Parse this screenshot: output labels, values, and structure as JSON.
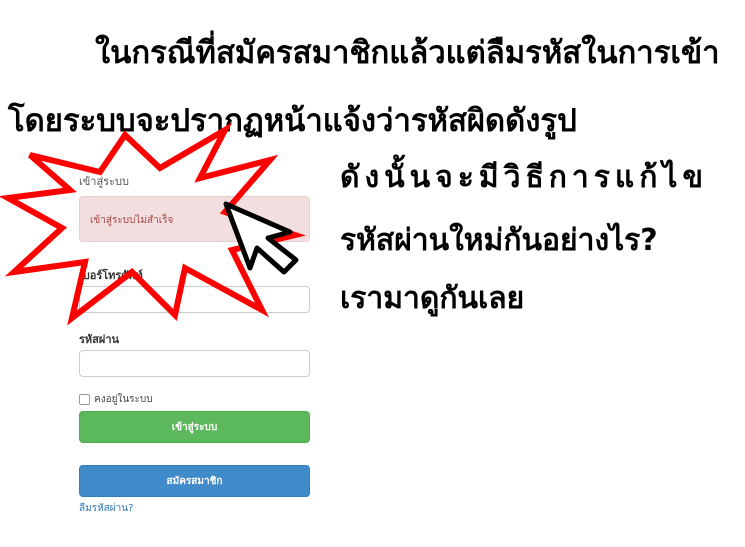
{
  "captions": {
    "line1": "ในกรณีที่สมัครสมาชิกแล้วแต่ลืมรหัสในการเข้า",
    "line2": "โดยระบบจะปรากฏหน้าแจ้งว่ารหัสผิดดังรูป",
    "line3": "ดังนั้นจะมีวิธีการแก้ไข",
    "line4": "รหัสผ่านใหม่กันอย่างไร?",
    "line5": "เรามาดูกันเลย"
  },
  "login": {
    "heading": "เข้าสู่ระบบ",
    "alert": "เข้าสู่ระบบไม่สำเร็จ",
    "phone_label": "เบอร์โทรศัพท์",
    "phone_value": "",
    "password_label": "รหัสผ่าน",
    "password_value": "",
    "remember_label": "คงอยู่ในระบบ",
    "login_button": "เข้าสู่ระบบ",
    "register_button": "สมัครสมาชิก",
    "forgot_link": "ลืมรหัสผ่าน?"
  },
  "icons": {
    "burst": "starburst-highlight",
    "cursor": "arrow-cursor-icon"
  },
  "colors": {
    "burst_stroke": "#ff0000",
    "alert_bg": "#f2dede",
    "alert_text": "#a94442",
    "login_button": "#5cb85c",
    "register_button": "#428bca",
    "link": "#337ab7"
  }
}
